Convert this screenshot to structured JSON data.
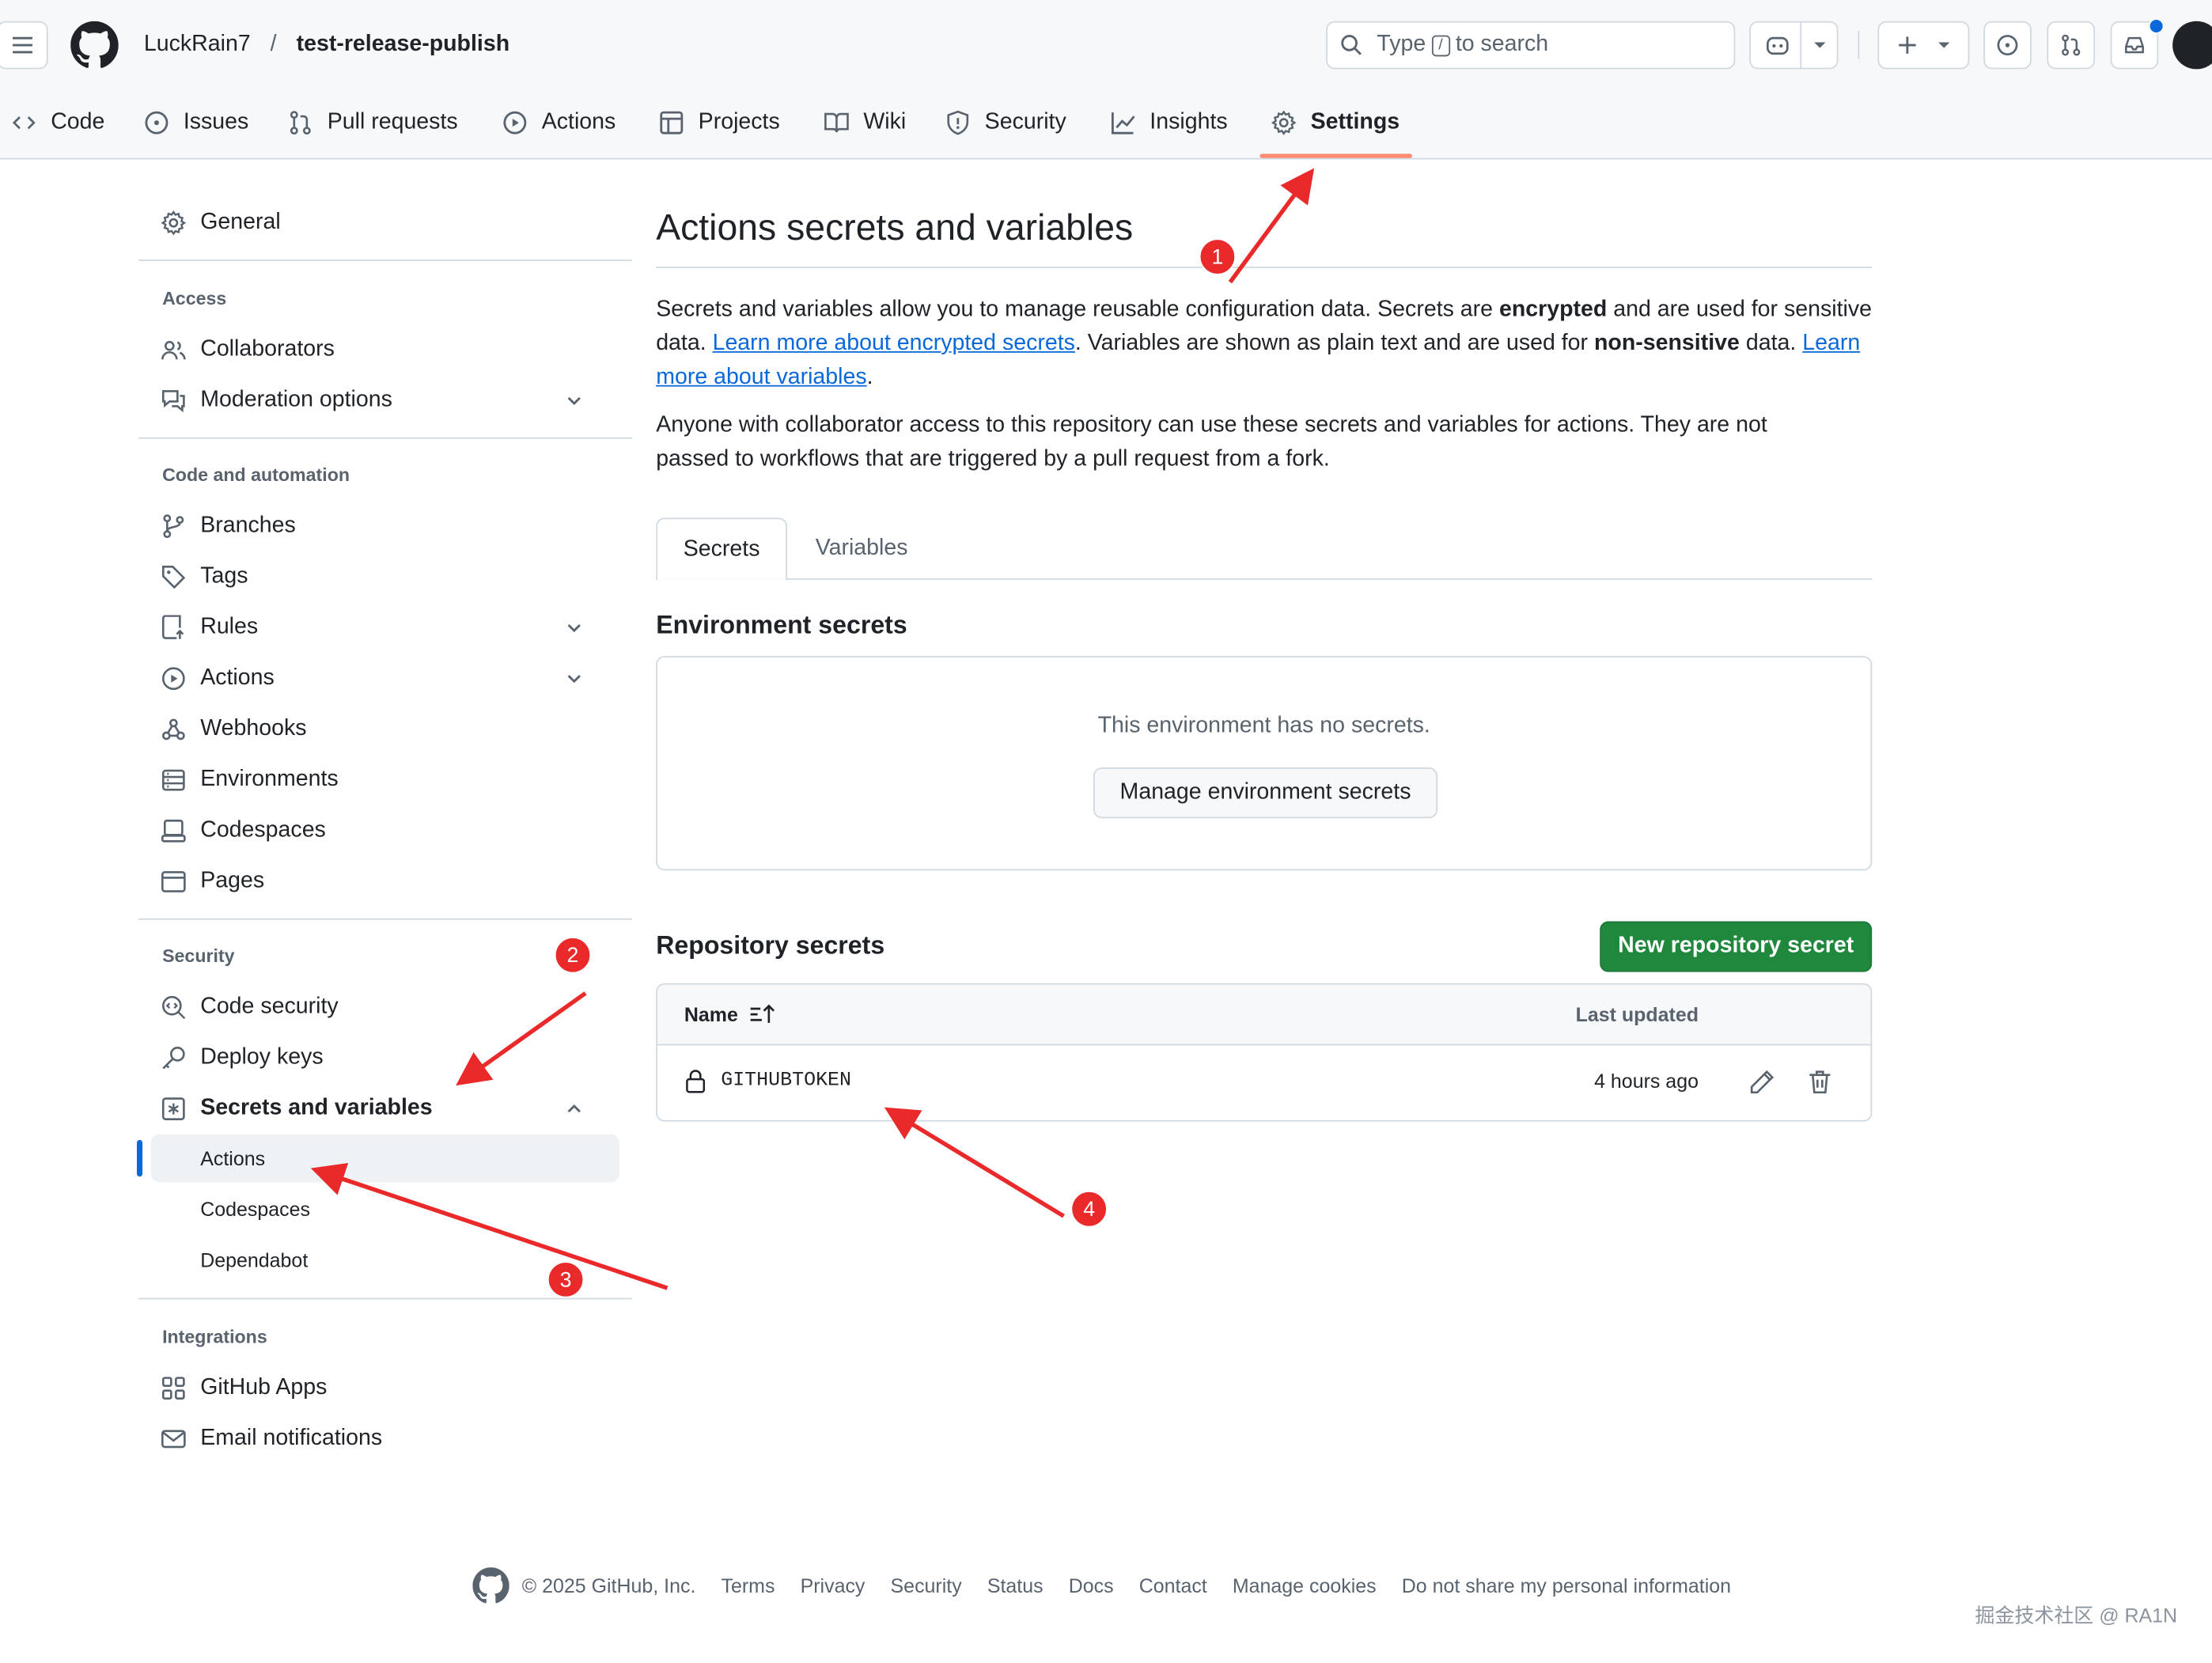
{
  "header": {
    "owner": "LuckRain7",
    "separator": "/",
    "repo": "test-release-publish",
    "search": {
      "prefix": "Type",
      "key": "/",
      "suffix": "to search"
    }
  },
  "repo_tabs": [
    {
      "label": "Code",
      "icon": "code-icon"
    },
    {
      "label": "Issues",
      "icon": "issue-icon"
    },
    {
      "label": "Pull requests",
      "icon": "pull-request-icon"
    },
    {
      "label": "Actions",
      "icon": "play-icon"
    },
    {
      "label": "Projects",
      "icon": "table-icon"
    },
    {
      "label": "Wiki",
      "icon": "book-icon"
    },
    {
      "label": "Security",
      "icon": "shield-icon"
    },
    {
      "label": "Insights",
      "icon": "graph-icon"
    },
    {
      "label": "Settings",
      "icon": "gear-icon",
      "selected": true
    }
  ],
  "sidebar": {
    "general": "General",
    "access_heading": "Access",
    "access": [
      "Collaborators",
      "Moderation options"
    ],
    "code_heading": "Code and automation",
    "code": [
      "Branches",
      "Tags",
      "Rules",
      "Actions",
      "Webhooks",
      "Environments",
      "Codespaces",
      "Pages"
    ],
    "security_heading": "Security",
    "security": [
      "Code security",
      "Deploy keys",
      "Secrets and variables"
    ],
    "secrets_sub": [
      "Actions",
      "Codespaces",
      "Dependabot"
    ],
    "integrations_heading": "Integrations",
    "integrations": [
      "GitHub Apps",
      "Email notifications"
    ]
  },
  "main": {
    "title": "Actions secrets and variables",
    "p1": {
      "a": "Secrets and variables allow you to manage reusable configuration data. Secrets are ",
      "b": "encrypted",
      "c": " and are used for sensitive data. ",
      "link1": "Learn more about encrypted secrets",
      "d": ". Variables are shown as plain text and are used for ",
      "e": "non-sensitive",
      "f": " data. ",
      "link2": "Learn more about variables",
      "g": "."
    },
    "p2": "Anyone with collaborator access to this repository can use these secrets and variables for actions. They are not passed to workflows that are triggered by a pull request from a fork.",
    "tabs": {
      "secrets": "Secrets",
      "variables": "Variables"
    },
    "env_heading": "Environment secrets",
    "env_empty": "This environment has no secrets.",
    "env_button": "Manage environment secrets",
    "repo_heading": "Repository secrets",
    "new_secret_button": "New repository secret",
    "table": {
      "col_name": "Name",
      "col_updated": "Last updated",
      "rows": [
        {
          "name": "GITHUBTOKEN",
          "updated": "4 hours ago"
        }
      ]
    }
  },
  "footer": {
    "copyright": "© 2025 GitHub, Inc.",
    "links": [
      "Terms",
      "Privacy",
      "Security",
      "Status",
      "Docs",
      "Contact",
      "Manage cookies",
      "Do not share my personal information"
    ]
  },
  "annotations": {
    "badges": [
      "1",
      "2",
      "3",
      "4"
    ],
    "color": "#ea2a2a"
  },
  "watermark": "掘金技术社区 @ RA1N",
  "colors": {
    "accent": "#0969da",
    "primary_button": "#1f883d",
    "tab_underline": "#fd8c73",
    "annotation": "#ea2a2a"
  }
}
